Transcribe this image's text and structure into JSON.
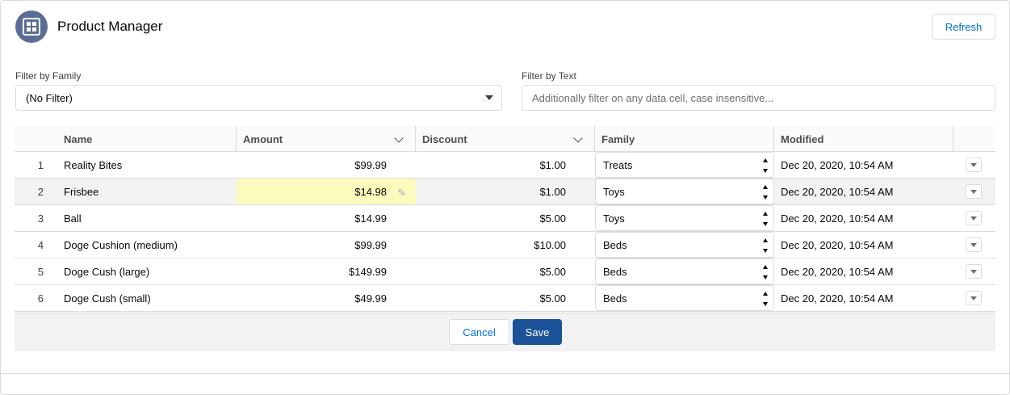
{
  "header": {
    "title": "Product Manager",
    "icon": "app-grid-icon",
    "refresh_label": "Refresh"
  },
  "filters": {
    "family_label": "Filter by Family",
    "family_value": "(No Filter)",
    "text_label": "Filter by Text",
    "text_placeholder": "Additionally filter on any data cell, case insensitive...",
    "text_value": ""
  },
  "table": {
    "columns": [
      "Name",
      "Amount",
      "Discount",
      "Family",
      "Modified"
    ],
    "rows": [
      {
        "num": "1",
        "name": "Reality Bites",
        "amount": "$99.99",
        "discount": "$1.00",
        "family": "Treats",
        "modified": "Dec 20, 2020, 10:54 AM"
      },
      {
        "num": "2",
        "name": "Frisbee",
        "amount": "$14.98",
        "discount": "$1.00",
        "family": "Toys",
        "modified": "Dec 20, 2020, 10:54 AM"
      },
      {
        "num": "3",
        "name": "Ball",
        "amount": "$14.99",
        "discount": "$5.00",
        "family": "Toys",
        "modified": "Dec 20, 2020, 10:54 AM"
      },
      {
        "num": "4",
        "name": "Doge Cushion (medium)",
        "amount": "$99.99",
        "discount": "$10.00",
        "family": "Beds",
        "modified": "Dec 20, 2020, 10:54 AM"
      },
      {
        "num": "5",
        "name": "Doge Cush (large)",
        "amount": "$149.99",
        "discount": "$5.00",
        "family": "Beds",
        "modified": "Dec 20, 2020, 10:54 AM"
      },
      {
        "num": "6",
        "name": "Doge Cush (small)",
        "amount": "$49.99",
        "discount": "$5.00",
        "family": "Beds",
        "modified": "Dec 20, 2020, 10:54 AM"
      }
    ]
  },
  "footer": {
    "cancel_label": "Cancel",
    "save_label": "Save"
  },
  "colors": {
    "brand": "#1b5297",
    "icon_bg": "#5a6d96",
    "edited_cell": "#fafbbd",
    "link": "#0070d2"
  }
}
